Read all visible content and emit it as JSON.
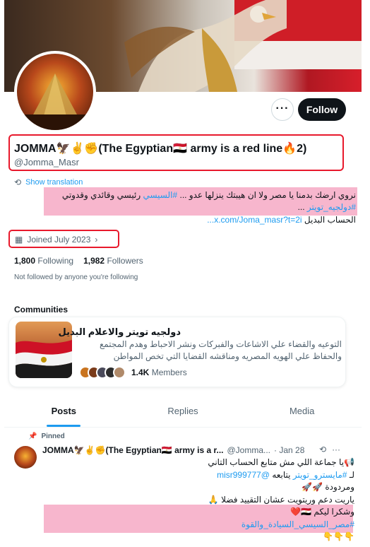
{
  "colors": {
    "accent": "#1d9bf0",
    "highlight_box": "#e8192c",
    "highlight_fill": "#f7b6cd"
  },
  "profile": {
    "display_name": "JOMMA🦅✌️✊(The Egyptian🇪🇬 army is a red line🔥2)",
    "handle": "@Jomma_Masr",
    "more_label": "···",
    "follow_label": "Follow",
    "show_translation": "Show translation",
    "bio_line1_text": "نروي ارضك بدمنا يا مصر ولا ان هيبتك ينزلها عدو ... ",
    "bio_line1_tag": "#السيسي",
    "bio_line1_rest": " رئيسي وقائدي وقدوتي",
    "bio_line2_tag": "#دولجيه_تويتر",
    "bio_line2_rest": " ...",
    "bio_line3_text": "الحساب البديل ",
    "bio_line3_link": "x.com/Joma_masr?t=2i...",
    "joined": "Joined July 2023",
    "following_count": "1,800",
    "following_label": "Following",
    "followers_count": "1,982",
    "followers_label": "Followers",
    "not_followed": "Not followed by anyone you're following"
  },
  "communities": {
    "title": "Communities",
    "name": "دولجيه تويتر والاعلام البديل",
    "description": "التوعيه والقضاء علي الاشاعات والفبركات ونشر الاحباط وهدم المجتمع والحفاظ علي الهويه المصريه ومناقشه القضايا التي تخص المواطن",
    "members_count": "1.4K",
    "members_label": "Members"
  },
  "tabs": [
    "Posts",
    "Replies",
    "Media"
  ],
  "post": {
    "pinned_label": "Pinned",
    "name": "JOMMA🦅✌️✊(The Egyptian🇪🇬 army is a r...",
    "handle": "@Jomma...",
    "date": "· Jan 28",
    "line1": "📢يا جماعة اللي مش متابع الحساب التاني",
    "line2_prefix": "لـ ",
    "line2_tag": "#مايسترو_تويتر",
    "line2_mid": " يتابعه ",
    "line2_mention": "@misr999777",
    "line3": "ومردودة 🚀🚀",
    "line4": "ياريت دعم وريتويت عشان التقييد فضلا 🙏",
    "line5": "وشكرا ليكم 🇪🇬❤️",
    "line6_tag": "#مصر_السيسي_السيادة_والقوة",
    "line7": "👇👇👇"
  }
}
